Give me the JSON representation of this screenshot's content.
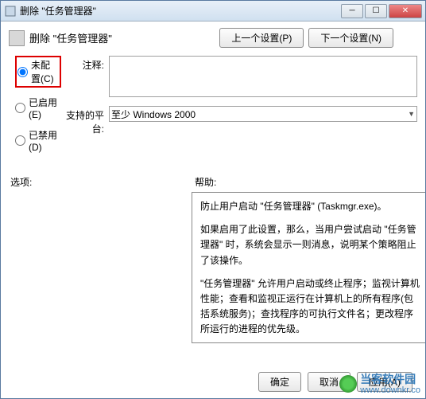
{
  "window": {
    "title": "删除 \"任务管理器\""
  },
  "header": {
    "label": "删除 \"任务管理器\"",
    "prev_button": "上一个设置(P)",
    "next_button": "下一个设置(N)"
  },
  "radios": {
    "not_configured": "未配置(C)",
    "enabled": "已启用(E)",
    "disabled": "已禁用(D)"
  },
  "fields": {
    "comment_label": "注释:",
    "comment_value": "",
    "platform_label": "支持的平台:",
    "platform_value": "至少 Windows 2000"
  },
  "sections": {
    "options_label": "选项:",
    "help_label": "帮助:"
  },
  "help": {
    "p1": "防止用户启动 \"任务管理器\" (Taskmgr.exe)。",
    "p2": "如果启用了此设置，那么，当用户尝试启动 \"任务管理器\" 时，系统会显示一则消息，说明某个策略阻止了该操作。",
    "p3": "\"任务管理器\" 允许用户启动或终止程序；监视计算机性能；查看和监视正运行在计算机上的所有程序(包括系统服务)；查找程序的可执行文件名；更改程序所运行的进程的优先级。"
  },
  "footer": {
    "ok": "确定",
    "cancel": "取消",
    "apply": "应用(A)"
  },
  "watermark": {
    "line1": "当客软件园",
    "line2": "www.downkr.co"
  }
}
